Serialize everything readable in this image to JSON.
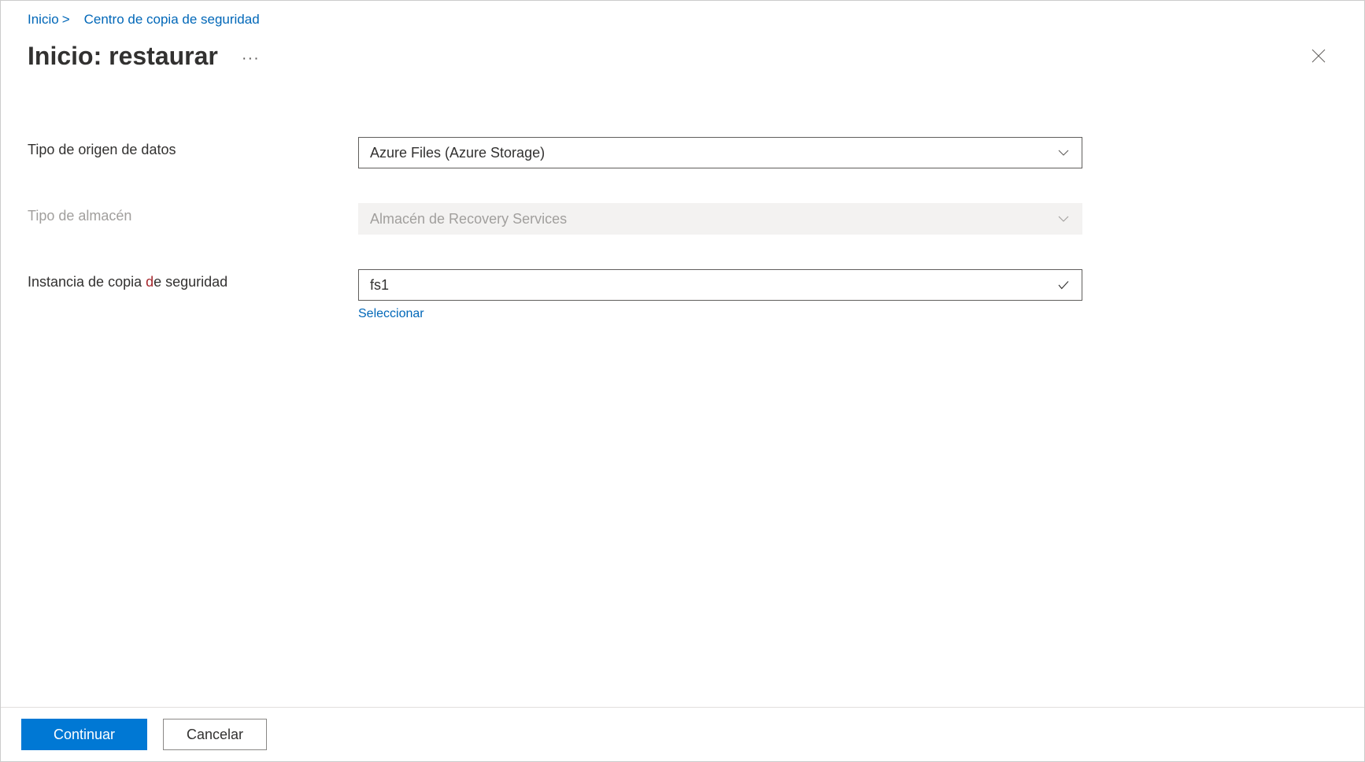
{
  "breadcrumb": {
    "home": "Inicio",
    "separator": ">",
    "secondary": "Centro de copia de seguridad"
  },
  "header": {
    "title": "Inicio: restaurar",
    "more": "···"
  },
  "form": {
    "datasource_type": {
      "label": "Tipo de origen de datos",
      "value": "Azure Files (Azure Storage)"
    },
    "vault_type": {
      "label": "Tipo de almacén",
      "value": "Almacén de Recovery Services"
    },
    "backup_instance": {
      "label_prefix": "Instancia de copia ",
      "label_suffix": "e seguridad",
      "value": "fs1",
      "help_link": "Seleccionar"
    }
  },
  "footer": {
    "continue": "Continuar",
    "cancel": "Cancelar"
  }
}
